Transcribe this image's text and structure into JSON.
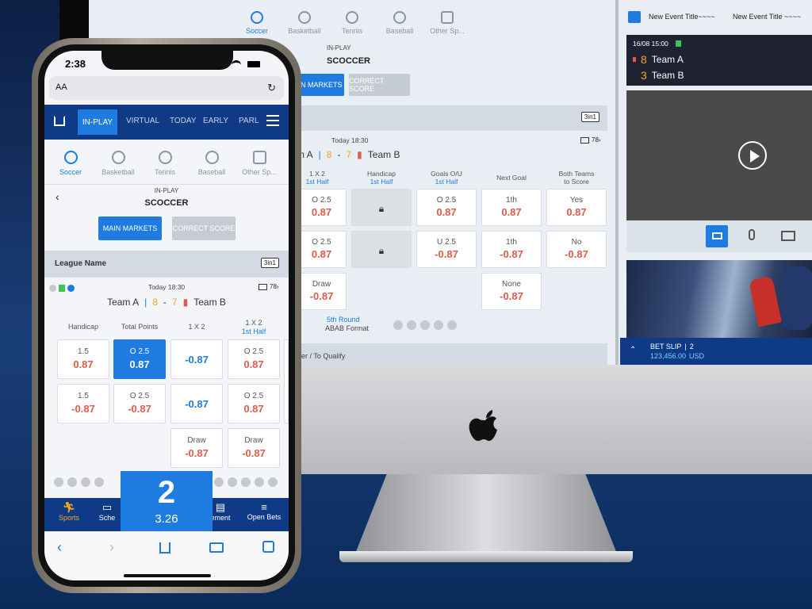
{
  "desktop": {
    "sports": [
      {
        "label": "Soccer",
        "icon": "soccer-icon",
        "active": true
      },
      {
        "label": "Basketball",
        "icon": "basketball-icon"
      },
      {
        "label": "Tennis",
        "icon": "tennis-icon"
      },
      {
        "label": "Baseball",
        "icon": "baseball-icon"
      },
      {
        "label": "Other Sp...",
        "icon": "trophy-icon"
      }
    ],
    "inplay_label": "IN-PLAY",
    "sport_title": "SCOCCER",
    "main_markets": "IN MARKETS",
    "correct_score": "CORRECT SCORE",
    "badge_3in1": "3in1",
    "time": "Today 18:30",
    "tv_count": "78",
    "team_a": "m A",
    "score_a": "8",
    "score_sep": "-",
    "score_b": "7",
    "team_b": "Team B",
    "headers": [
      {
        "main": "1 X 2",
        "sub": "1st Half"
      },
      {
        "main": "Handicap",
        "sub": "1st Half"
      },
      {
        "main": "Goals O/U",
        "sub": "1st Half"
      },
      {
        "main": "Next Goal",
        "sub": ""
      },
      {
        "main": "Both Teams",
        "sub2": "to Score"
      }
    ],
    "cells": {
      "c1r1_lab": "O 2.5",
      "c1r1_val": "0.87",
      "c1r2_lab": "O 2.5",
      "c1r2_val": "0.87",
      "c1r3_lab": "Draw",
      "c1r3_val": "-0.87",
      "c3r1_lab": "O 2.5",
      "c3r1_val": "0.87",
      "c3r2_lab": "U 2.5",
      "c3r2_val": "-0.87",
      "c4r1_lab": "1th",
      "c4r1_val": "0.87",
      "c4r2_lab": "1th",
      "c4r2_val": "-0.87",
      "c4r3_lab": "None",
      "c4r3_val": "-0.87",
      "c5r1_lab": "Yes",
      "c5r1_val": "0.87",
      "c5r2_lab": "No",
      "c5r2_val": "-0.87"
    },
    "round": "5th Round",
    "format": "ABAB Format",
    "footer_text": "er / To Qualify"
  },
  "right_panel": {
    "event_title_1": "New Event Title~~~~",
    "event_title_2": "New Event Title ~~~~",
    "datetime": "16/08  15:00",
    "team_a_score": "8",
    "team_a": "Team A",
    "team_b_score": "3",
    "team_b": "Team B",
    "betslip_label": "BET SLIP",
    "betslip_sep": "|",
    "betslip_count": "2",
    "betslip_amount": "123,456.00",
    "betslip_currency": "USD"
  },
  "phone": {
    "clock": "2:38",
    "address_aa": "AA",
    "nav": [
      "IN-PLAY",
      "VIRTUAL",
      "TODAY",
      "EARLY",
      "PARL"
    ],
    "sports": [
      {
        "label": "Soccer",
        "active": true
      },
      {
        "label": "Basketball"
      },
      {
        "label": "Tennis"
      },
      {
        "label": "Baseball"
      },
      {
        "label": "Other Sp..."
      }
    ],
    "inplay_label": "IN-PLAY",
    "sport_title": "SCOCCER",
    "main_markets": "MAIN MARKETS",
    "correct_score": "CORRECT SCORE",
    "league_name": "League Name",
    "badge_3in1": "3in1",
    "time": "Today 18:30",
    "tv_count": "78",
    "team_a": "Team A",
    "score_a": "8",
    "score_sep": "-",
    "score_b": "7",
    "team_b": "Team B",
    "headers": [
      {
        "main": "Handicap"
      },
      {
        "main": "Total Points"
      },
      {
        "main": "1 X 2"
      },
      {
        "main": "1 X 2",
        "sub": "1st Half"
      }
    ],
    "cells": {
      "h1_lab": "1.5",
      "h1_val": "0.87",
      "h2_lab": "1.5",
      "h2_val": "-0.87",
      "t1_lab": "O 2.5",
      "t1_val": "0.87",
      "t2_lab": "O 2.5",
      "t2_val": "-0.87",
      "x1_val": "-0.87",
      "x2_val": "-0.87",
      "x3_lab": "Draw",
      "x3_val": "-0.87",
      "y1_lab": "O 2.5",
      "y1_val": "0.87",
      "y2_lab": "O 2.5",
      "y2_val": "0.87",
      "y3_lab": "Draw",
      "y3_val": "-0.87"
    },
    "tabbar": [
      {
        "label": "Sports",
        "icon": "runner-icon"
      },
      {
        "label": "Sche",
        "icon": "schedule-icon"
      },
      {
        "label": "ement",
        "icon": "statement-icon"
      },
      {
        "label": "Open Bets",
        "icon": "open-bets-icon"
      }
    ],
    "betslip_count": "2",
    "betslip_odds": "3.26"
  },
  "colors": {
    "accent": "#1e7be0",
    "navy": "#0f3a86",
    "odds_red": "#e05a4b",
    "orange": "#f5a623"
  }
}
